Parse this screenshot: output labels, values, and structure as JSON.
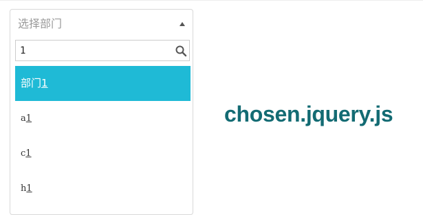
{
  "select": {
    "placeholder": "选择部门",
    "search_value": "1",
    "icons": {
      "arrow": "triangle-up-icon",
      "search": "magnifier-icon"
    },
    "results": [
      {
        "prefix": "部门",
        "match": "1",
        "highlighted": true
      },
      {
        "prefix": "a",
        "match": "1",
        "highlighted": false
      },
      {
        "prefix": "c",
        "match": "1",
        "highlighted": false
      },
      {
        "prefix": "h",
        "match": "1",
        "highlighted": false
      }
    ]
  },
  "brand": {
    "text": "chosen.jquery.js"
  },
  "colors": {
    "highlight": "#1fbad6",
    "brand": "#136b73",
    "border": "#d8d8d8"
  }
}
